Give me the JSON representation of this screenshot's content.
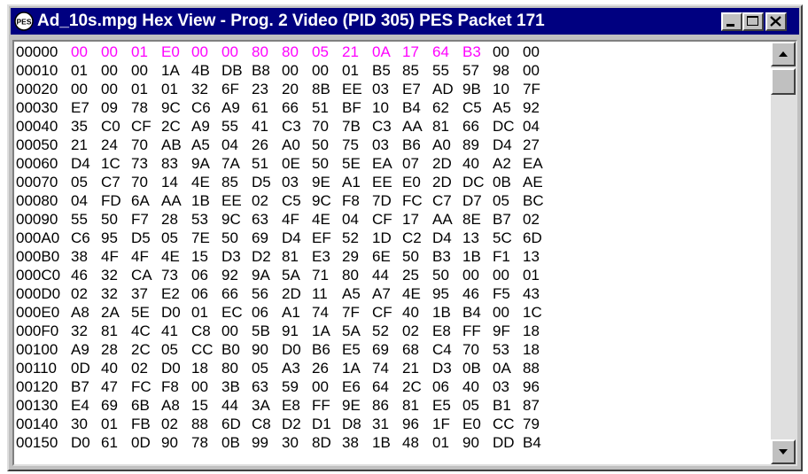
{
  "window": {
    "title": "Ad_10s.mpg Hex View - Prog. 2 Video (PID 305) PES Packet 171",
    "app_icon_text": "PES"
  },
  "hex": {
    "highlight_color": "#ff00ff",
    "highlight_count": 14,
    "rows": [
      {
        "offset": "00000",
        "bytes": [
          "00",
          "00",
          "01",
          "E0",
          "00",
          "00",
          "80",
          "80",
          "05",
          "21",
          "0A",
          "17",
          "64",
          "B3",
          "00",
          "00"
        ]
      },
      {
        "offset": "00010",
        "bytes": [
          "01",
          "00",
          "00",
          "1A",
          "4B",
          "DB",
          "B8",
          "00",
          "00",
          "01",
          "B5",
          "85",
          "55",
          "57",
          "98",
          "00"
        ]
      },
      {
        "offset": "00020",
        "bytes": [
          "00",
          "00",
          "01",
          "01",
          "32",
          "6F",
          "23",
          "20",
          "8B",
          "EE",
          "03",
          "E7",
          "AD",
          "9B",
          "10",
          "7F"
        ]
      },
      {
        "offset": "00030",
        "bytes": [
          "E7",
          "09",
          "78",
          "9C",
          "C6",
          "A9",
          "61",
          "66",
          "51",
          "BF",
          "10",
          "B4",
          "62",
          "C5",
          "A5",
          "92"
        ]
      },
      {
        "offset": "00040",
        "bytes": [
          "35",
          "C0",
          "CF",
          "2C",
          "A9",
          "55",
          "41",
          "C3",
          "70",
          "7B",
          "C3",
          "AA",
          "81",
          "66",
          "DC",
          "04"
        ]
      },
      {
        "offset": "00050",
        "bytes": [
          "21",
          "24",
          "70",
          "AB",
          "A5",
          "04",
          "26",
          "A0",
          "50",
          "75",
          "03",
          "B6",
          "A0",
          "89",
          "D4",
          "27"
        ]
      },
      {
        "offset": "00060",
        "bytes": [
          "D4",
          "1C",
          "73",
          "83",
          "9A",
          "7A",
          "51",
          "0E",
          "50",
          "5E",
          "EA",
          "07",
          "2D",
          "40",
          "A2",
          "EA"
        ]
      },
      {
        "offset": "00070",
        "bytes": [
          "05",
          "C7",
          "70",
          "14",
          "4E",
          "85",
          "D5",
          "03",
          "9E",
          "A1",
          "EE",
          "E0",
          "2D",
          "DC",
          "0B",
          "AE"
        ]
      },
      {
        "offset": "00080",
        "bytes": [
          "04",
          "FD",
          "6A",
          "AA",
          "1B",
          "EE",
          "02",
          "C5",
          "9C",
          "F8",
          "7D",
          "FC",
          "C7",
          "D7",
          "05",
          "BC"
        ]
      },
      {
        "offset": "00090",
        "bytes": [
          "55",
          "50",
          "F7",
          "28",
          "53",
          "9C",
          "63",
          "4F",
          "4E",
          "04",
          "CF",
          "17",
          "AA",
          "8E",
          "B7",
          "02"
        ]
      },
      {
        "offset": "000A0",
        "bytes": [
          "C6",
          "95",
          "D5",
          "05",
          "7E",
          "50",
          "69",
          "D4",
          "EF",
          "52",
          "1D",
          "C2",
          "D4",
          "13",
          "5C",
          "6D"
        ]
      },
      {
        "offset": "000B0",
        "bytes": [
          "38",
          "4F",
          "4F",
          "4E",
          "15",
          "D3",
          "D2",
          "81",
          "E3",
          "29",
          "6E",
          "50",
          "B3",
          "1B",
          "F1",
          "13"
        ]
      },
      {
        "offset": "000C0",
        "bytes": [
          "46",
          "32",
          "CA",
          "73",
          "06",
          "92",
          "9A",
          "5A",
          "71",
          "80",
          "44",
          "25",
          "50",
          "00",
          "00",
          "01"
        ]
      },
      {
        "offset": "000D0",
        "bytes": [
          "02",
          "32",
          "37",
          "E2",
          "06",
          "66",
          "56",
          "2D",
          "11",
          "A5",
          "A7",
          "4E",
          "95",
          "46",
          "F5",
          "43"
        ]
      },
      {
        "offset": "000E0",
        "bytes": [
          "A8",
          "2A",
          "5E",
          "D0",
          "01",
          "EC",
          "06",
          "A1",
          "74",
          "7F",
          "CF",
          "40",
          "1B",
          "B4",
          "00",
          "1C"
        ]
      },
      {
        "offset": "000F0",
        "bytes": [
          "32",
          "81",
          "4C",
          "41",
          "C8",
          "00",
          "5B",
          "91",
          "1A",
          "5A",
          "52",
          "02",
          "E8",
          "FF",
          "9F",
          "18"
        ]
      },
      {
        "offset": "00100",
        "bytes": [
          "A9",
          "28",
          "2C",
          "05",
          "CC",
          "B0",
          "90",
          "D0",
          "B6",
          "E5",
          "69",
          "68",
          "C4",
          "70",
          "53",
          "18"
        ]
      },
      {
        "offset": "00110",
        "bytes": [
          "0D",
          "40",
          "02",
          "D0",
          "18",
          "80",
          "05",
          "A3",
          "26",
          "1A",
          "74",
          "21",
          "D3",
          "0B",
          "0A",
          "88"
        ]
      },
      {
        "offset": "00120",
        "bytes": [
          "B7",
          "47",
          "FC",
          "F8",
          "00",
          "3B",
          "63",
          "59",
          "00",
          "E6",
          "64",
          "2C",
          "06",
          "40",
          "03",
          "96"
        ]
      },
      {
        "offset": "00130",
        "bytes": [
          "E4",
          "69",
          "6B",
          "A8",
          "15",
          "44",
          "3A",
          "E8",
          "FF",
          "9E",
          "86",
          "81",
          "E5",
          "05",
          "B1",
          "87"
        ]
      },
      {
        "offset": "00140",
        "bytes": [
          "30",
          "01",
          "FB",
          "02",
          "88",
          "6D",
          "C8",
          "D2",
          "D1",
          "D8",
          "31",
          "96",
          "1F",
          "E0",
          "CC",
          "79"
        ]
      },
      {
        "offset": "00150",
        "bytes": [
          "D0",
          "61",
          "0D",
          "90",
          "78",
          "0B",
          "99",
          "30",
          "8D",
          "38",
          "1B",
          "48",
          "01",
          "90",
          "DD",
          "B4"
        ]
      }
    ]
  },
  "scrollbar": {
    "position": 0
  }
}
